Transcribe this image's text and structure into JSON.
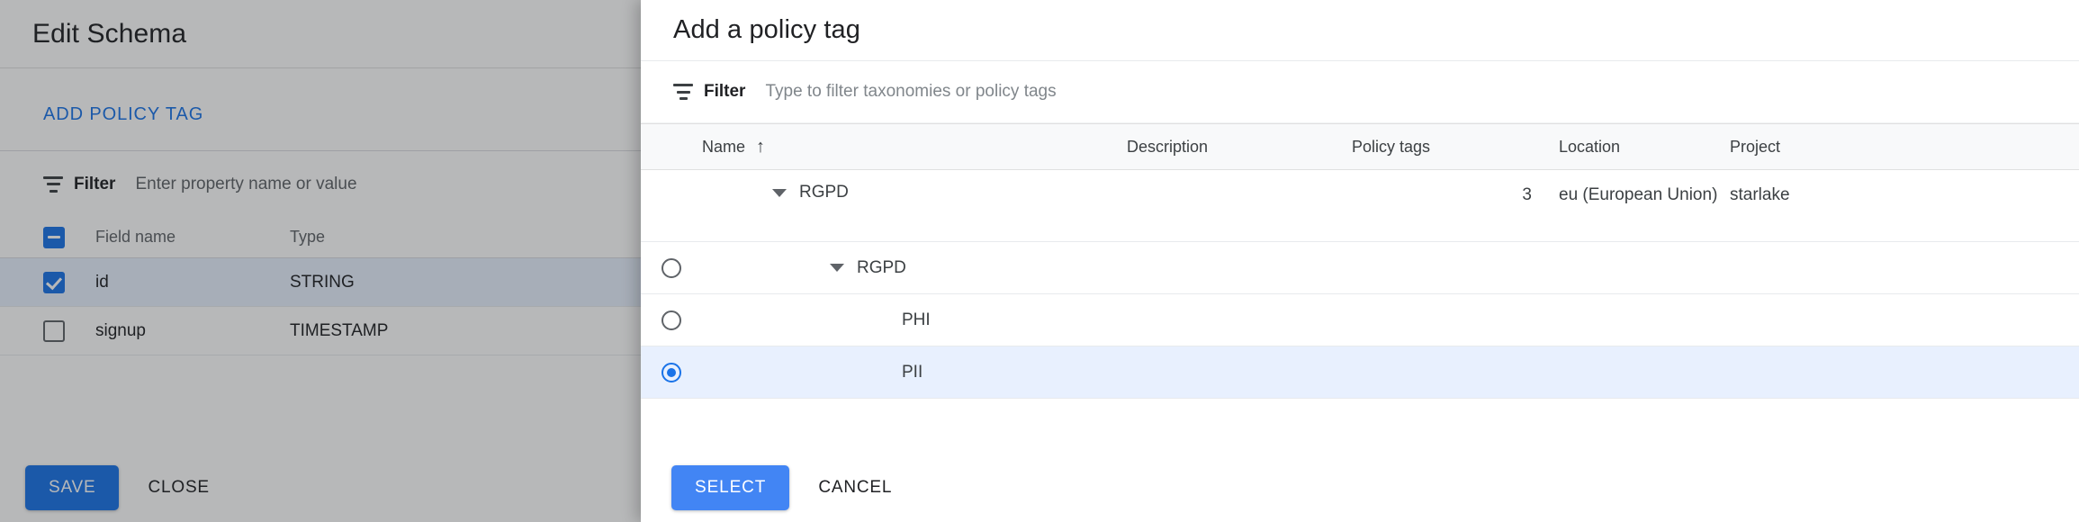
{
  "background_panel": {
    "title": "Edit Schema",
    "add_policy_tag_label": "ADD POLICY TAG",
    "filter": {
      "label": "Filter",
      "placeholder": "Enter property name or value"
    },
    "table": {
      "headers": {
        "field_name": "Field name",
        "type": "Type"
      },
      "rows": [
        {
          "field_name": "id",
          "type": "STRING",
          "checked": true,
          "selected": true
        },
        {
          "field_name": "signup",
          "type": "TIMESTAMP",
          "checked": false,
          "selected": false
        }
      ]
    },
    "actions": {
      "save_label": "SAVE",
      "close_label": "CLOSE"
    }
  },
  "dialog": {
    "title": "Add a policy tag",
    "filter": {
      "label": "Filter",
      "placeholder": "Type to filter taxonomies or policy tags"
    },
    "table": {
      "headers": {
        "name": "Name",
        "sort_arrow": "↑",
        "description": "Description",
        "policy_tags": "Policy tags",
        "location": "Location",
        "project": "Project"
      },
      "taxonomy_row": {
        "name": "RGPD",
        "description": "",
        "policy_tags": "3",
        "location": "eu (European Union)",
        "project": "starlake",
        "expanded": true
      },
      "tag_rows": [
        {
          "name": "RGPD",
          "has_expander": true,
          "indent": 1,
          "selected": false
        },
        {
          "name": "PHI",
          "has_expander": false,
          "indent": 2,
          "selected": false
        },
        {
          "name": "PII",
          "has_expander": false,
          "indent": 2,
          "selected": true
        }
      ]
    },
    "actions": {
      "select_label": "SELECT",
      "cancel_label": "CANCEL"
    }
  },
  "colors": {
    "accent_blue": "#1a73e8",
    "select_button_blue": "#4285f4",
    "selected_row": "#e8f0fe",
    "header_bg": "#f8f9fa",
    "text_primary": "#202124",
    "text_secondary": "#5f6368"
  }
}
